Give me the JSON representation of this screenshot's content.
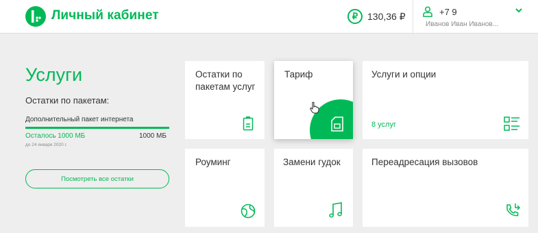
{
  "colors": {
    "accent": "#00b956",
    "background": "#eeeeee",
    "card": "#ffffff"
  },
  "header": {
    "brand": "Личный кабинет",
    "balance": "130,36 ₽",
    "currency_symbol": "₽",
    "phone": "+7 9",
    "user_name": "Иванов Иван Иванов..."
  },
  "services": {
    "title": "Услуги",
    "subtitle": "Остатки по пакетам:",
    "package": {
      "name": "Дополнительный пакет интернета",
      "remaining": "Осталось 1000 МБ",
      "total": "1000 МБ",
      "date": "до 24 января 2020 г.",
      "progress_fraction": 1.0
    },
    "view_all_button": "Посмотреть все остатки"
  },
  "cards": {
    "remains": {
      "label": "Остатки по пакетам услуг",
      "icon": "battery-icon"
    },
    "tariff": {
      "label": "Тариф",
      "icon": "sim-card-icon"
    },
    "options": {
      "label": "Услуги и опции",
      "count": "8 услуг",
      "icon": "list-icon"
    },
    "roaming": {
      "label": "Роуминг",
      "icon": "globe-icon"
    },
    "ringtone": {
      "label": "Замени гудок",
      "icon": "music-note-icon"
    },
    "forwarding": {
      "label": "Переадресация вызовов",
      "icon": "call-forward-icon"
    }
  }
}
